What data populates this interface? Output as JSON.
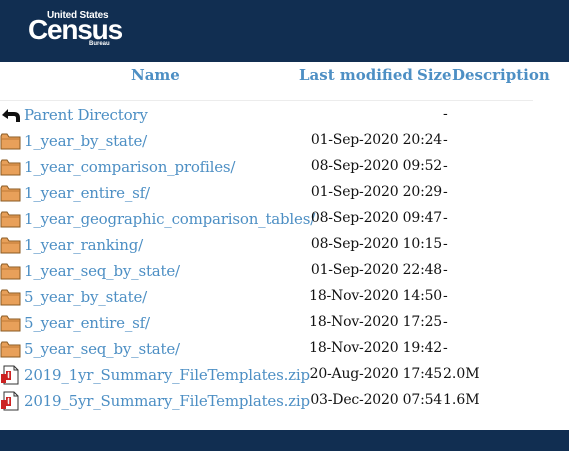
{
  "header": {
    "logo_top": "United States",
    "logo_main": "Census",
    "logo_sub": "Bureau",
    "background": "#112e51"
  },
  "columns": {
    "name": "Name",
    "last_modified": "Last modified",
    "size": "Size",
    "description": "Description"
  },
  "parent": {
    "label": "Parent Directory",
    "size": "-"
  },
  "rows": [
    {
      "icon": "folder-icon",
      "name": "1_year_by_state/",
      "date": "01-Sep-2020 20:24",
      "size": "-"
    },
    {
      "icon": "folder-icon",
      "name": "1_year_comparison_profiles/",
      "date": "08-Sep-2020 09:52",
      "size": "-"
    },
    {
      "icon": "folder-icon",
      "name": "1_year_entire_sf/",
      "date": "01-Sep-2020 20:29",
      "size": "-"
    },
    {
      "icon": "folder-icon",
      "name": "1_year_geographic_comparison_tables/",
      "date": "08-Sep-2020 09:47",
      "size": "-"
    },
    {
      "icon": "folder-icon",
      "name": "1_year_ranking/",
      "date": "08-Sep-2020 10:15",
      "size": "-"
    },
    {
      "icon": "folder-icon",
      "name": "1_year_seq_by_state/",
      "date": "01-Sep-2020 22:48",
      "size": "-"
    },
    {
      "icon": "folder-icon",
      "name": "5_year_by_state/",
      "date": "18-Nov-2020 14:50",
      "size": "-"
    },
    {
      "icon": "folder-icon",
      "name": "5_year_entire_sf/",
      "date": "18-Nov-2020 17:25",
      "size": "-"
    },
    {
      "icon": "folder-icon",
      "name": "5_year_seq_by_state/",
      "date": "18-Nov-2020 19:42",
      "size": "-"
    },
    {
      "icon": "compressed-file-icon",
      "name": "2019_1yr_Summary_FileTemplates.zip",
      "date": "20-Aug-2020 17:45",
      "size": "2.0M"
    },
    {
      "icon": "compressed-file-icon",
      "name": "2019_5yr_Summary_FileTemplates.zip",
      "date": "03-Dec-2020 07:54",
      "size": "1.6M"
    }
  ]
}
